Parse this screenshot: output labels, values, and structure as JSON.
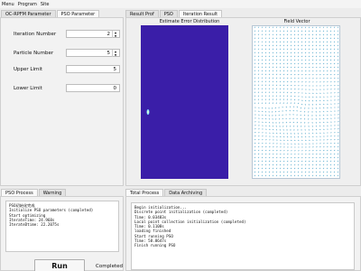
{
  "menu": [
    "Menu",
    "Program",
    "Site"
  ],
  "left_tabs": [
    {
      "label": "OC-RPFM Parameter",
      "active": false
    },
    {
      "label": "PSO Parameter",
      "active": true
    }
  ],
  "right_tabs": [
    {
      "label": "Result Prof",
      "active": false
    },
    {
      "label": "PSO",
      "active": false
    },
    {
      "label": "Iteration Result",
      "active": true
    }
  ],
  "params": {
    "iteration": {
      "label": "Iteration Number",
      "value": "2"
    },
    "particle": {
      "label": "Particle Number",
      "value": "5"
    },
    "upper": {
      "label": "Upper Limit",
      "value": "5"
    },
    "lower": {
      "label": "Lower Limit",
      "value": "0"
    }
  },
  "charts": {
    "error_title": "Estimate Error Distribution",
    "field_title": "Field Vector",
    "heatmap_background_color": "#3a1ea8",
    "heatmap_spot_color": "#7fe3ff"
  },
  "bottom_left_tabs": [
    {
      "label": "PSO Process",
      "active": true
    },
    {
      "label": "Warning",
      "active": false
    }
  ],
  "bottom_right_tabs": [
    {
      "label": "Total Process",
      "active": true
    },
    {
      "label": "Data Archiving",
      "active": false
    }
  ],
  "pso_log": [
    "PSO初始化完成",
    "Initialize PSO parameters (completed)",
    "Start optimizing",
    "IterateTime: 24.968s",
    "IterateDtime: 22.2075s"
  ],
  "total_log": [
    "Begin initialization...",
    "Discrete point initialization (completed)",
    "Time: 0.03483s",
    "Local point collection initialization (completed)",
    "Time: 0.1108s",
    "loading finished",
    "Start running PSO",
    "Time: 58.8647s",
    "Finish running PSO"
  ],
  "run_button": "Run",
  "status": "Completed"
}
